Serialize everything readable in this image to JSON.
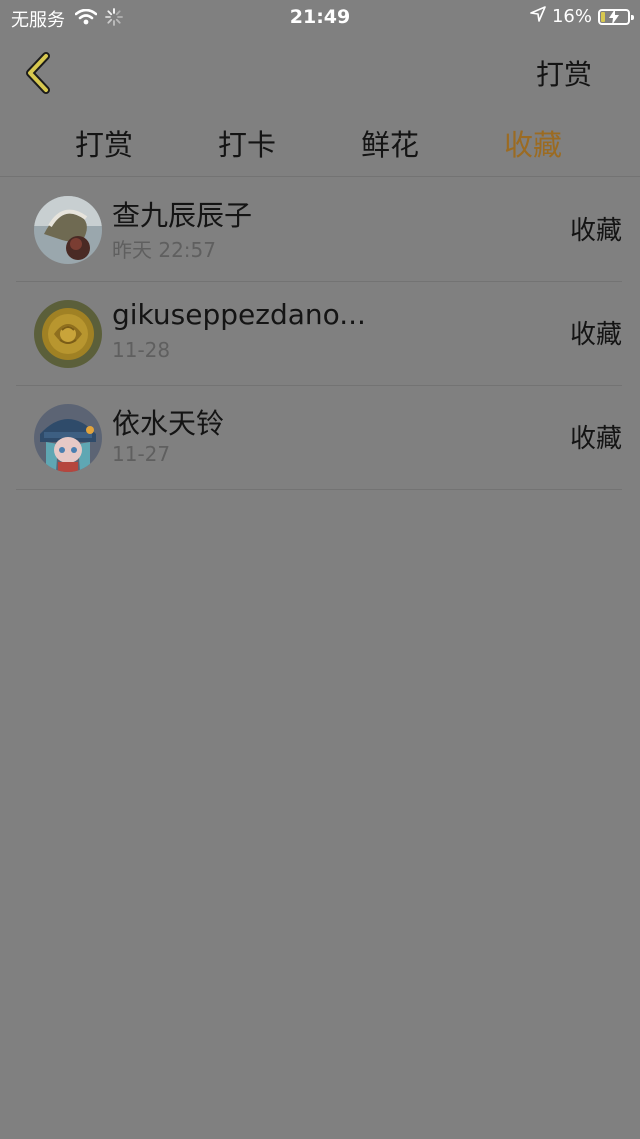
{
  "status_bar": {
    "carrier": "无服务",
    "time": "21:49",
    "battery_percent": "16%",
    "battery_level": 0.16
  },
  "nav": {
    "back_icon": "chevron-left-icon",
    "action_label": "打赏"
  },
  "tabs": [
    {
      "label": "打赏",
      "active": false
    },
    {
      "label": "打卡",
      "active": false
    },
    {
      "label": "鲜花",
      "active": false
    },
    {
      "label": "收藏",
      "active": true
    }
  ],
  "list": [
    {
      "name": "查九辰辰子",
      "time": "昨天 22:57",
      "action": "收藏",
      "avatar": "photo-avatar"
    },
    {
      "name": "gikuseppezdano...",
      "time": "11-28",
      "action": "收藏",
      "avatar": "yellow-rose-avatar"
    },
    {
      "name": "依水天铃",
      "time": "11-27",
      "action": "收藏",
      "avatar": "anime-girl-avatar"
    }
  ],
  "colors": {
    "background": "#808080",
    "accent": "#9b6b22",
    "divider": "#737373"
  }
}
